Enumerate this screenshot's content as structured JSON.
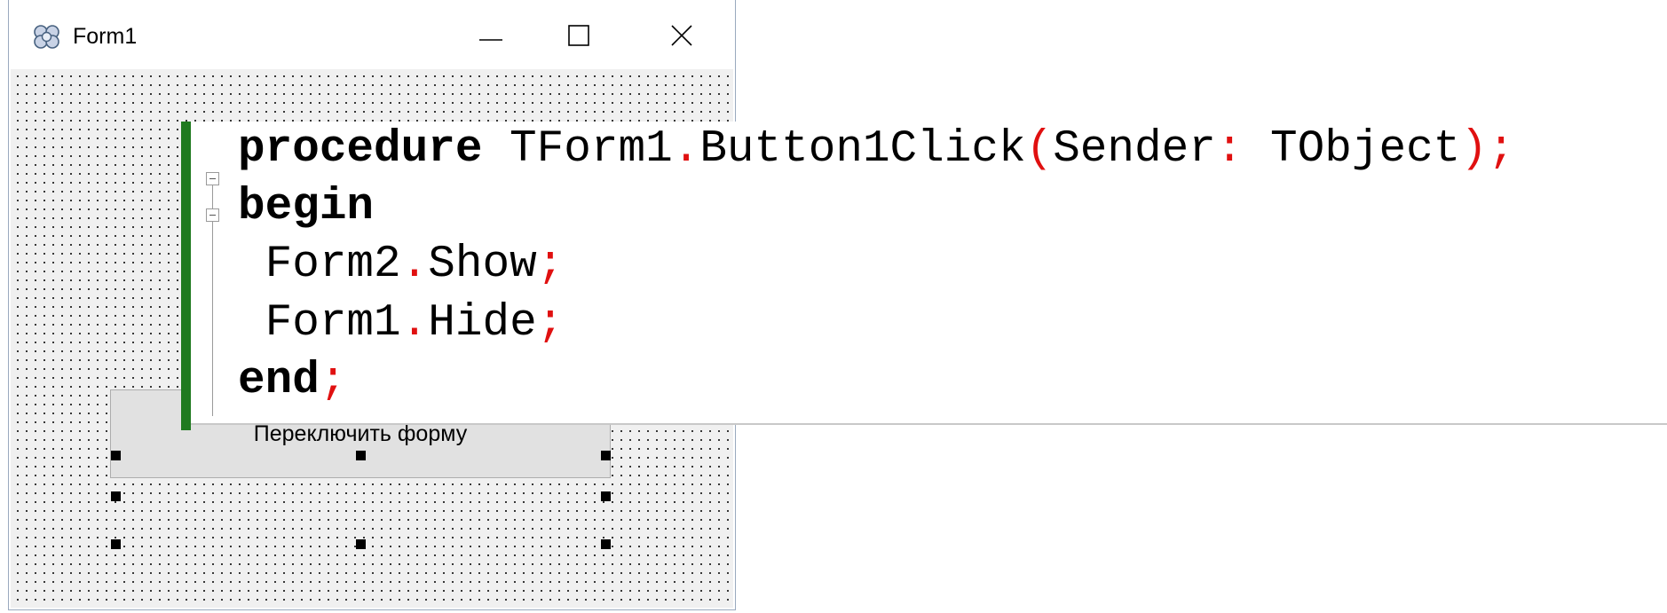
{
  "window": {
    "title": "Form1",
    "icon": "delphi-form-icon",
    "controls": {
      "minimize_icon": "minimize-icon",
      "maximize_icon": "maximize-icon",
      "close_icon": "close-icon"
    }
  },
  "form": {
    "button": {
      "label": "Переключить форму",
      "selected": true
    }
  },
  "code": {
    "lines": [
      {
        "tokens": [
          {
            "text": "procedure",
            "kind": "keyword"
          },
          {
            "text": " TForm1",
            "kind": "ident"
          },
          {
            "text": ".",
            "kind": "punct"
          },
          {
            "text": "Button1Click",
            "kind": "ident"
          },
          {
            "text": "(",
            "kind": "punct"
          },
          {
            "text": "Sender",
            "kind": "ident"
          },
          {
            "text": ":",
            "kind": "punct"
          },
          {
            "text": " TObject",
            "kind": "ident"
          },
          {
            "text": ");",
            "kind": "punct"
          }
        ]
      },
      {
        "tokens": [
          {
            "text": "begin",
            "kind": "keyword"
          }
        ]
      },
      {
        "tokens": [
          {
            "text": " Form2",
            "kind": "ident"
          },
          {
            "text": ".",
            "kind": "punct"
          },
          {
            "text": "Show",
            "kind": "ident"
          },
          {
            "text": ";",
            "kind": "punct"
          }
        ]
      },
      {
        "tokens": [
          {
            "text": " Form1",
            "kind": "ident"
          },
          {
            "text": ".",
            "kind": "punct"
          },
          {
            "text": "Hide",
            "kind": "ident"
          },
          {
            "text": ";",
            "kind": "punct"
          }
        ]
      },
      {
        "tokens": [
          {
            "text": "end",
            "kind": "keyword"
          },
          {
            "text": ";",
            "kind": "punct"
          }
        ]
      }
    ]
  },
  "colors": {
    "keyword": "#000000",
    "punctuation": "#e01010",
    "change_bar": "#1f7a1f",
    "designer_grid_dot": "#1a1a1a",
    "button_face": "#e1e1e1"
  }
}
